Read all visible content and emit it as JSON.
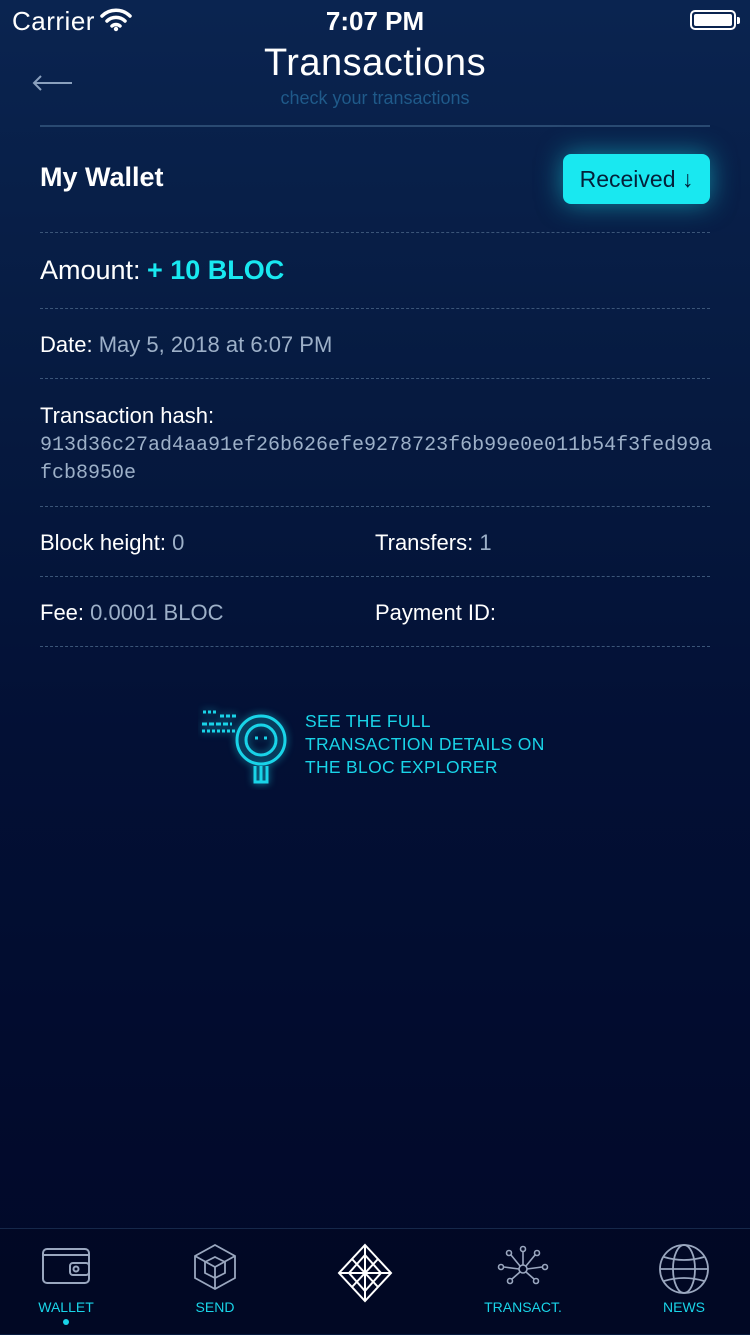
{
  "status_bar": {
    "carrier": "Carrier",
    "time": "7:07 PM"
  },
  "header": {
    "title": "Transactions",
    "subtitle": "check your transactions"
  },
  "wallet": {
    "name": "My Wallet",
    "direction_label": "Received ↓"
  },
  "amount": {
    "label": "Amount: ",
    "value": "+ 10 BLOC"
  },
  "date": {
    "label": "Date: ",
    "value": "May 5, 2018 at 6:07 PM"
  },
  "hash": {
    "label": "Transaction hash:",
    "value": "913d36c27ad4aa91ef26b626efe9278723f6b99e0e011b54f3fed99afcb8950e"
  },
  "block_height": {
    "label": "Block height: ",
    "value": "0"
  },
  "transfers": {
    "label": "Transfers: ",
    "value": "1"
  },
  "fee": {
    "label": "Fee: ",
    "value": "0.0001 BLOC"
  },
  "payment_id": {
    "label": "Payment ID: ",
    "value": ""
  },
  "explorer_link": {
    "text": "SEE THE FULL TRANSACTION DETAILS ON THE BLOC EXPLORER"
  },
  "tabs": [
    {
      "label": "WALLET",
      "icon": "wallet-icon",
      "active": true
    },
    {
      "label": "SEND",
      "icon": "send-cube-icon",
      "active": false
    },
    {
      "label": "",
      "icon": "bloc-logo-icon",
      "active": false
    },
    {
      "label": "TRANSACT.",
      "icon": "network-nodes-icon",
      "active": false
    },
    {
      "label": "NEWS",
      "icon": "globe-icon",
      "active": false
    }
  ],
  "colors": {
    "accent": "#19e8f0",
    "background_top": "#0a2450",
    "background_bottom": "#010828",
    "muted_value": "#9db0c8"
  }
}
